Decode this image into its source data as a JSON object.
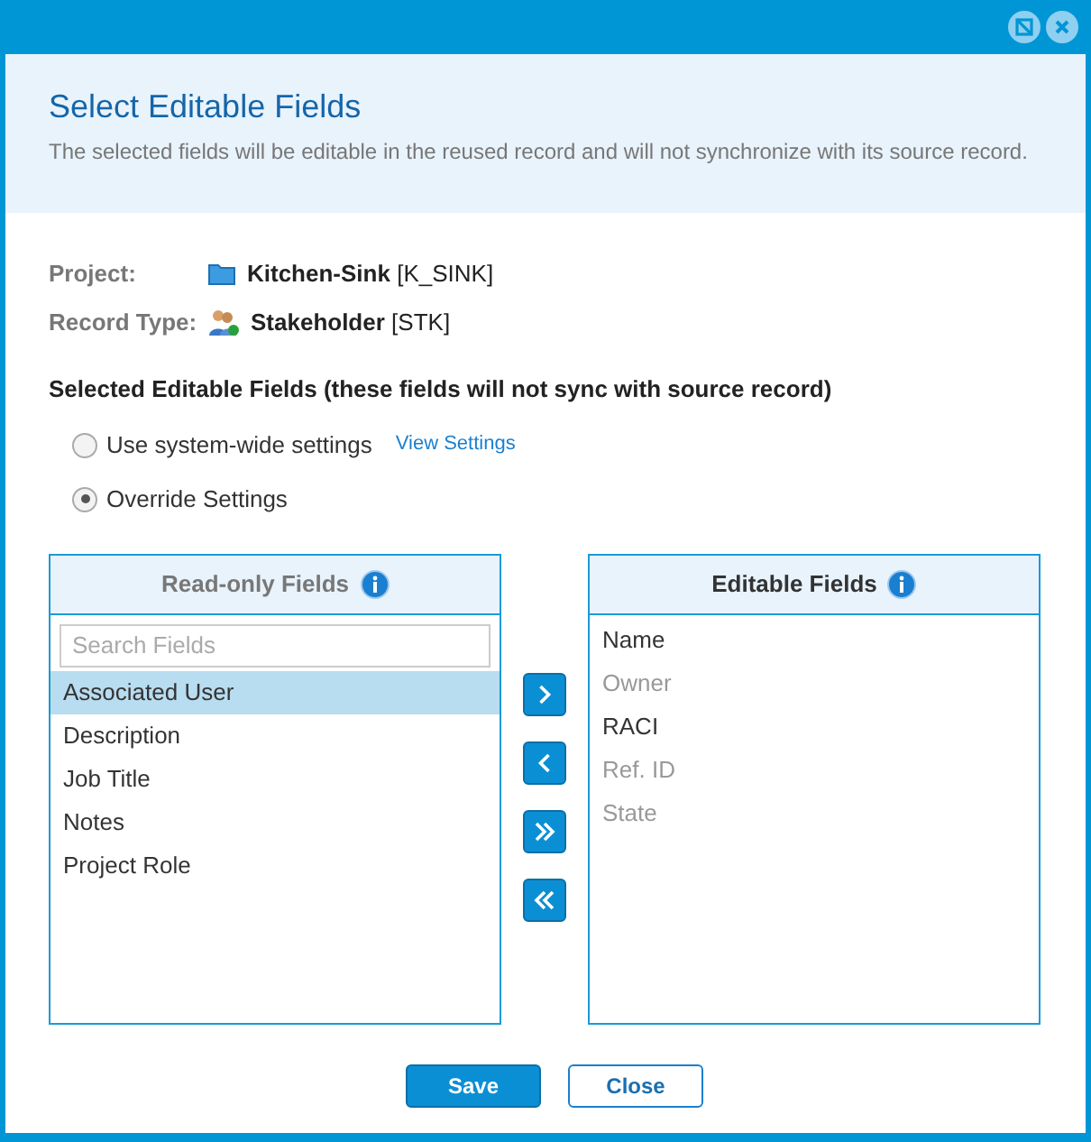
{
  "dialog": {
    "title": "Select Editable Fields",
    "description": "The selected fields will be editable in the reused record and will not synchronize with its source record."
  },
  "info": [
    {
      "kind": "project",
      "label": "Project:",
      "name": "Kitchen-Sink",
      "code": "[K_SINK]"
    },
    {
      "kind": "record_type",
      "label": "Record Type:",
      "name": "Stakeholder",
      "code": "[STK]"
    }
  ],
  "section_title": "Selected Editable Fields (these fields will not sync with source record)",
  "options": [
    {
      "label": "Use system-wide settings",
      "selected": false,
      "link": "View Settings"
    },
    {
      "label": "Override Settings",
      "selected": true
    }
  ],
  "read_only_list": {
    "title": "Read-only Fields",
    "search": {
      "placeholder": "Search Fields"
    },
    "items": [
      {
        "label": "Associated User",
        "selected": true
      },
      {
        "label": "Description",
        "selected": false
      },
      {
        "label": "Job Title",
        "selected": false
      },
      {
        "label": "Notes",
        "selected": false
      },
      {
        "label": "Project Role",
        "selected": false
      }
    ]
  },
  "move_buttons": [
    {
      "kind": "right"
    },
    {
      "kind": "left"
    },
    {
      "kind": "all_right"
    },
    {
      "kind": "all_left"
    }
  ],
  "editable_list": {
    "title": "Editable Fields",
    "items": [
      {
        "label": "Name",
        "disabled": false
      },
      {
        "label": "Owner",
        "disabled": true
      },
      {
        "label": "RACI",
        "disabled": false
      },
      {
        "label": "Ref. ID",
        "disabled": true
      },
      {
        "label": "State",
        "disabled": true
      }
    ]
  },
  "buttons": [
    {
      "kind": "primary",
      "label": "Save"
    },
    {
      "kind": "secondary",
      "label": "Close"
    }
  ]
}
